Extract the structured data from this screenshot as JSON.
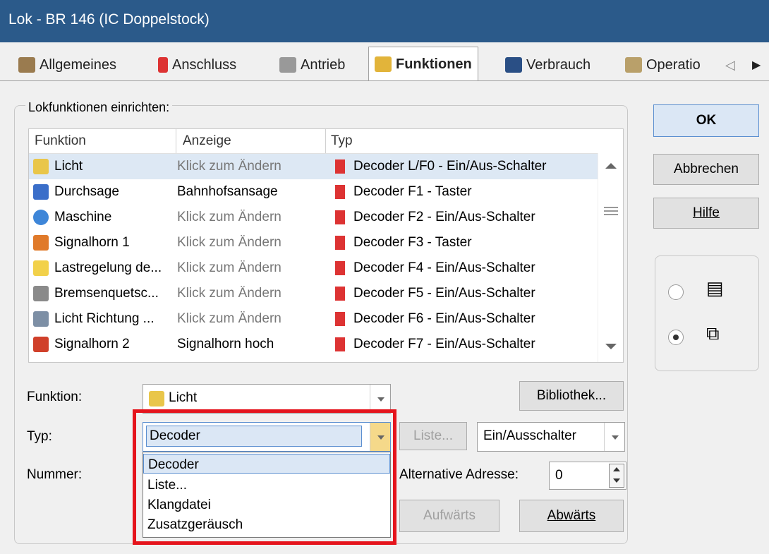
{
  "window": {
    "title": "Lok - BR 146 (IC Doppelstock)"
  },
  "tabs": [
    {
      "label": "Allgemeines",
      "icon": "house-icon"
    },
    {
      "label": "Anschluss",
      "icon": "plug-icon"
    },
    {
      "label": "Antrieb",
      "icon": "engine-icon"
    },
    {
      "label": "Funktionen",
      "icon": "functions-icon",
      "active": true
    },
    {
      "label": "Verbrauch",
      "icon": "fuel-icon"
    },
    {
      "label": "Operatio",
      "icon": "operations-icon"
    }
  ],
  "tab_scroll": {
    "left": "◁",
    "right": "▶"
  },
  "group": {
    "label": "Lokfunktionen einrichten:"
  },
  "table": {
    "columns": [
      "Funktion",
      "Anzeige",
      "Typ"
    ],
    "rows": [
      {
        "name": "Licht",
        "anzeige": "Klick zum Ändern",
        "typ": "Decoder L/F0 - Ein/Aus-Schalter",
        "selected": true
      },
      {
        "name": "Durchsage",
        "anzeige": "Bahnhofsansage",
        "typ": "Decoder F1 - Taster"
      },
      {
        "name": "Maschine",
        "anzeige": "Klick zum Ändern",
        "typ": "Decoder F2 - Ein/Aus-Schalter"
      },
      {
        "name": "Signalhorn 1",
        "anzeige": "Klick zum Ändern",
        "typ": "Decoder F3 - Taster"
      },
      {
        "name": "Lastregelung de...",
        "anzeige": "Klick zum Ändern",
        "typ": "Decoder F4 - Ein/Aus-Schalter"
      },
      {
        "name": "Bremsenquetsc...",
        "anzeige": "Klick zum Ändern",
        "typ": "Decoder F5 - Ein/Aus-Schalter"
      },
      {
        "name": "Licht Richtung ...",
        "anzeige": "Klick zum Ändern",
        "typ": "Decoder F6 - Ein/Aus-Schalter"
      },
      {
        "name": "Signalhorn 2",
        "anzeige": "Signalhorn hoch",
        "typ": "Decoder F7 - Ein/Aus-Schalter"
      }
    ]
  },
  "form": {
    "funktion_label": "Funktion:",
    "funktion_value": "Licht",
    "typ_label": "Typ:",
    "typ_value": "Decoder",
    "typ_options": [
      "Decoder",
      "Liste...",
      "Klangdatei",
      "Zusatzgeräusch"
    ],
    "nummer_label": "Nummer:",
    "liste_button": "Liste...",
    "mode_value": "Ein/Ausschalter",
    "alt_address_label": "Alternative Adresse:",
    "alt_address_value": "0",
    "bibliothek_button": "Bibliothek...",
    "aufwaerts_button": "Aufwärts",
    "abwaerts_button": "Abwärts"
  },
  "dialog_buttons": {
    "ok": "OK",
    "cancel": "Abbrechen",
    "help": "Hilfe"
  },
  "view_options": [
    {
      "icon": "list-view-icon",
      "glyph": "▤",
      "selected": false
    },
    {
      "icon": "copy-view-icon",
      "glyph": "⧉",
      "selected": true
    }
  ],
  "colors": {
    "titlebar": "#2b5a8a",
    "accent": "#5b8fd0",
    "highlight": "#e5141c"
  }
}
